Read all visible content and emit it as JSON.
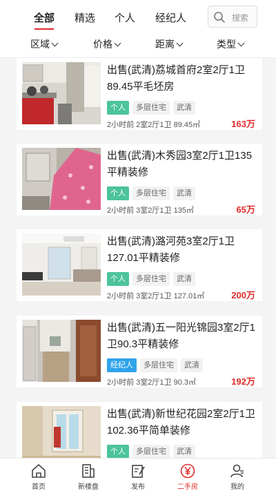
{
  "tabs": [
    "全部",
    "精选",
    "个人",
    "经纪人"
  ],
  "search_placeholder": "搜索",
  "filters": [
    "区域",
    "价格",
    "距离",
    "类型"
  ],
  "listings": [
    {
      "title": "出售(武清)荔城首府2室2厅1卫89.45平毛坯房",
      "seller": "个人",
      "building_type": "多层住宅",
      "district": "武清",
      "meta": "2小时前 2室2厅1卫 89.45㎡",
      "price": "163万"
    },
    {
      "title": "出售(武清)木秀园3室2厅1卫135平精装修",
      "seller": "个人",
      "building_type": "多层住宅",
      "district": "武清",
      "meta": "2小时前 3室2厅1卫 135㎡",
      "price": "65万"
    },
    {
      "title": "出售(武清)潞河苑3室2厅1卫127.01平精装修",
      "seller": "个人",
      "building_type": "多层住宅",
      "district": "武清",
      "meta": "2小时前 3室2厅1卫 127.01㎡",
      "price": "200万"
    },
    {
      "title": "出售(武清)五一阳光锦园3室2厅1卫90.3平精装修",
      "seller": "经纪人",
      "building_type": "多层住宅",
      "district": "武清",
      "meta": "2小时前 3室2厅1卫 90.3㎡",
      "price": "192万"
    },
    {
      "title": "出售(武清)新世纪花园2室2厅1卫102.36平简单装修",
      "seller": "个人",
      "building_type": "多层住宅",
      "district": "武清",
      "meta": "",
      "price": ""
    }
  ],
  "bottom_nav": [
    "首页",
    "新楼盘",
    "发布",
    "二手房",
    "我的"
  ],
  "colors": {
    "accent": "#e02a2a",
    "tag_person": "#4cc39a",
    "tag_agent": "#2ea3ea"
  }
}
